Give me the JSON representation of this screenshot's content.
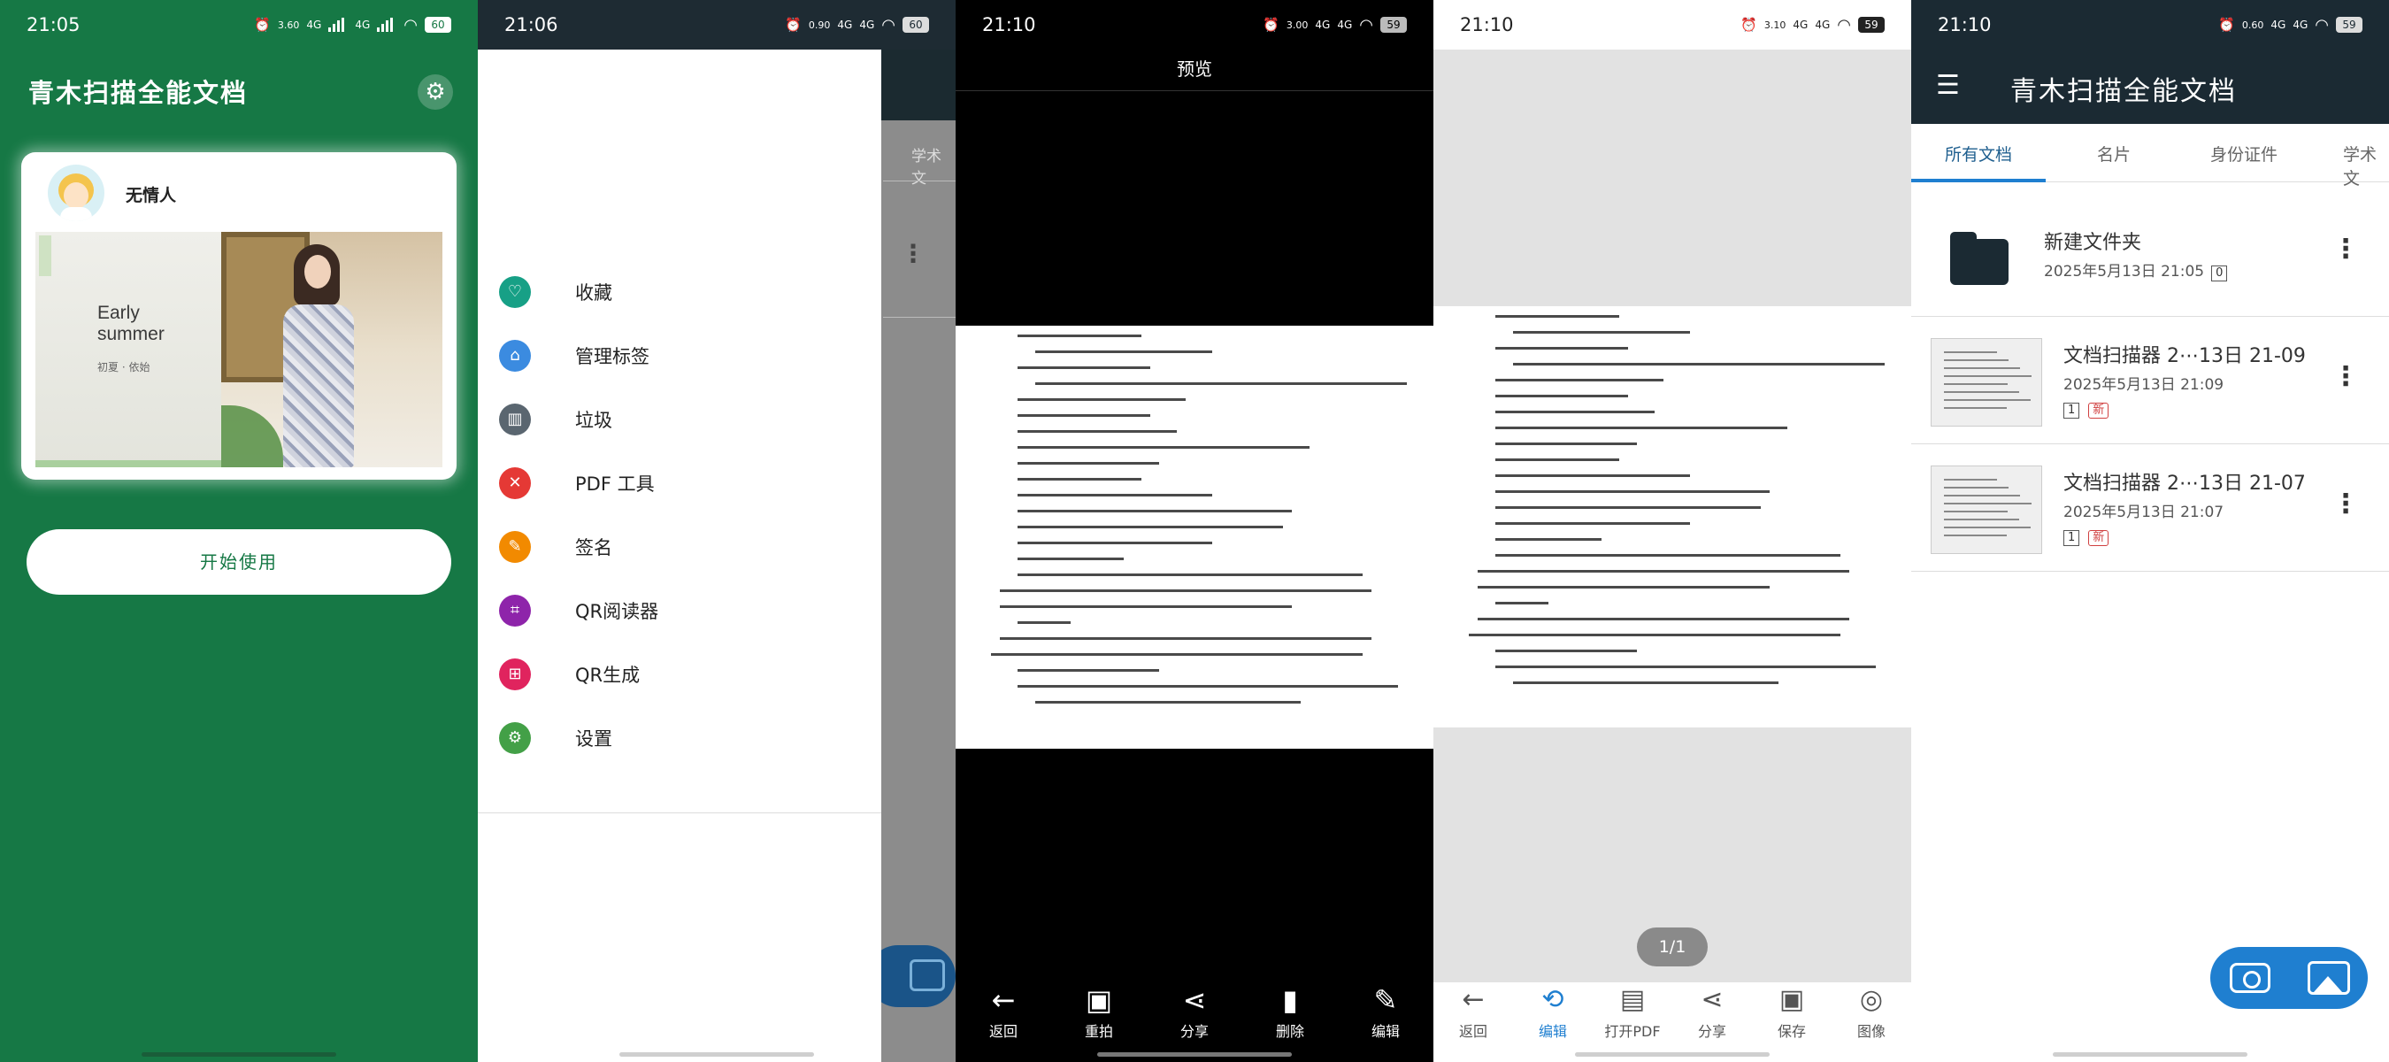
{
  "colors": {
    "brand_green": "#167845",
    "dark_header": "#1b2a33",
    "accent_blue": "#1f7fd0",
    "new_badge": "#d04040"
  },
  "screens": {
    "intro": {
      "status": {
        "time": "21:05",
        "speed": "3.60",
        "speed_unit": "KB/s",
        "net1": "4G",
        "net2": "4G",
        "battery": "60"
      },
      "app_title": "青木扫描全能文档",
      "user_name": "无情人",
      "banner_en": "Early summer",
      "banner_cn": "初夏 · 依始",
      "start_label": "开始使用"
    },
    "drawer": {
      "status": {
        "time": "21:06",
        "speed": "0.90",
        "speed_unit": "KB/s",
        "net1": "4G",
        "net2": "4G",
        "battery": "60"
      },
      "behind_tab": "学术文",
      "items": [
        {
          "label": "收藏",
          "icon": "heart-icon",
          "color": "#17a086",
          "glyph": "♡"
        },
        {
          "label": "管理标签",
          "icon": "tag-icon",
          "color": "#3b8be0",
          "glyph": "⌂"
        },
        {
          "label": "垃圾",
          "icon": "trash-icon",
          "color": "#5a6670",
          "glyph": "▥"
        },
        {
          "label": "PDF 工具",
          "icon": "tools-icon",
          "color": "#e53935",
          "glyph": "✕"
        },
        {
          "label": "签名",
          "icon": "signature-icon",
          "color": "#f28a00",
          "glyph": "✎"
        },
        {
          "label": "QR阅读器",
          "icon": "qr-reader-icon",
          "color": "#8e24aa",
          "glyph": "⌗"
        },
        {
          "label": "QR生成",
          "icon": "qr-generate-icon",
          "color": "#e0245e",
          "glyph": "⊞"
        },
        {
          "label": "设置",
          "icon": "settings-icon",
          "color": "#43a047",
          "glyph": "⚙"
        }
      ]
    },
    "preview": {
      "status": {
        "time": "21:10",
        "speed": "3.00",
        "speed_unit": "KB/s",
        "net1": "4G",
        "net2": "4G",
        "battery": "59"
      },
      "title": "预览",
      "buttons": [
        {
          "label": "返回",
          "icon": "arrow-left-icon",
          "glyph": "←"
        },
        {
          "label": "重拍",
          "icon": "retake-icon",
          "glyph": "▣"
        },
        {
          "label": "分享",
          "icon": "share-icon",
          "glyph": "⋖"
        },
        {
          "label": "删除",
          "icon": "delete-icon",
          "glyph": "▮"
        },
        {
          "label": "编辑",
          "icon": "edit-icon",
          "glyph": "✎"
        }
      ]
    },
    "editor": {
      "status": {
        "time": "21:10",
        "speed": "3.10",
        "speed_unit": "KB/s",
        "net1": "4G",
        "net2": "4G",
        "battery": "59"
      },
      "page_indicator": "1/1",
      "buttons": [
        {
          "label": "返回",
          "icon": "arrow-left-icon",
          "glyph": "←",
          "active": false
        },
        {
          "label": "编辑",
          "icon": "crop-icon",
          "glyph": "⟲",
          "active": true
        },
        {
          "label": "打开PDF",
          "icon": "pdf-icon",
          "glyph": "▤",
          "active": false
        },
        {
          "label": "分享",
          "icon": "share-icon",
          "glyph": "⋖",
          "active": false
        },
        {
          "label": "保存",
          "icon": "save-icon",
          "glyph": "▣",
          "active": false
        },
        {
          "label": "图像",
          "icon": "image-icon",
          "glyph": "◎",
          "active": false
        }
      ]
    },
    "home": {
      "status": {
        "time": "21:10",
        "speed": "0.60",
        "speed_unit": "KB/s",
        "net1": "4G",
        "net2": "4G",
        "battery": "59"
      },
      "title": "青木扫描全能文档",
      "tabs": [
        "所有文档",
        "名片",
        "身份证件",
        "学术文"
      ],
      "folder": {
        "name": "新建文件夹",
        "date": "2025年5月13日 21:05",
        "count": "0"
      },
      "docs": [
        {
          "name": "文档扫描器 2⋯13日 21-09",
          "date": "2025年5月13日 21:09",
          "pages": "1",
          "badge": "新"
        },
        {
          "name": "文档扫描器 2⋯13日 21-07",
          "date": "2025年5月13日 21:07",
          "pages": "1",
          "badge": "新"
        }
      ]
    }
  }
}
